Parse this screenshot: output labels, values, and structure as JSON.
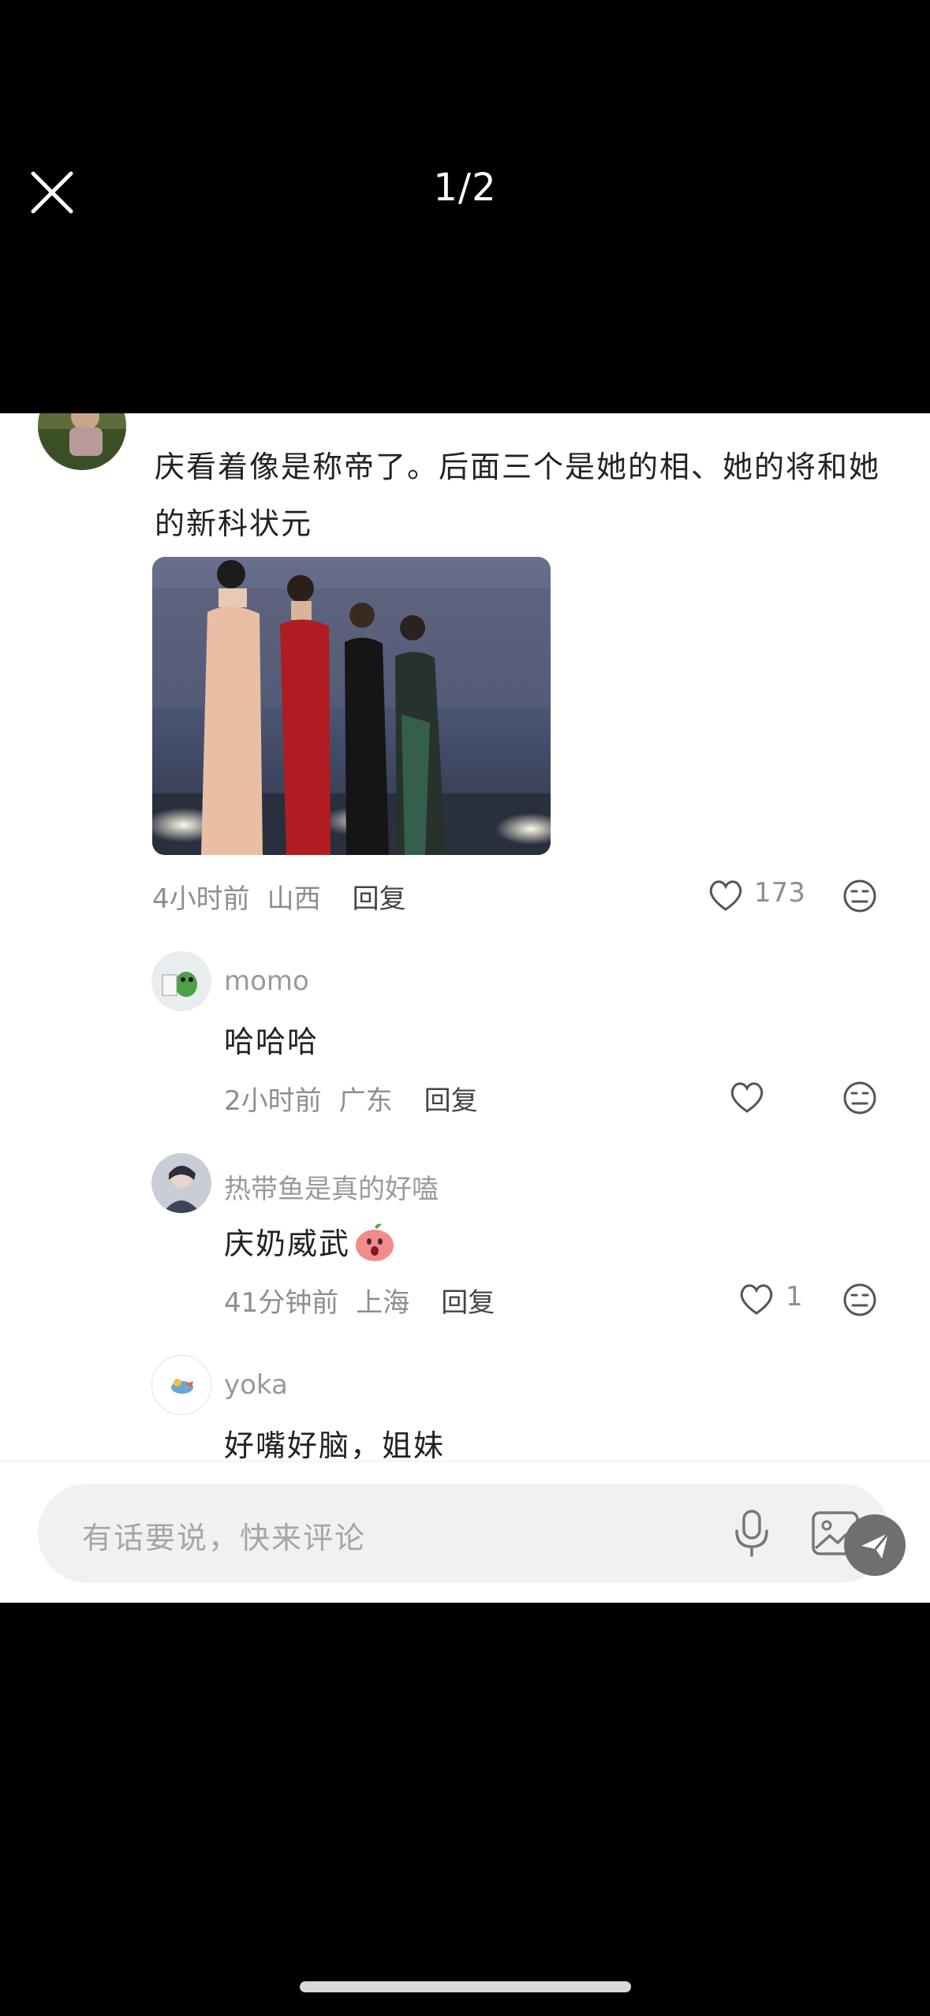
{
  "viewer": {
    "counter": "1/2"
  },
  "main_comment": {
    "text": "庆看着像是称帝了。后面三个是她的相、她的将和她的新科状元",
    "time": "4小时前",
    "location": "山西",
    "reply_label": "回复",
    "likes": "173"
  },
  "replies": [
    {
      "username": "momo",
      "text": "哈哈哈",
      "time": "2小时前",
      "location": "广东",
      "reply_label": "回复",
      "likes": ""
    },
    {
      "username": "热带鱼是真的好嗑",
      "text": "庆奶威武",
      "time": "41分钟前",
      "location": "上海",
      "reply_label": "回复",
      "likes": "1"
    },
    {
      "username": "yoka",
      "text": "好嘴好脑，姐妹"
    }
  ],
  "composer": {
    "placeholder": "有话要说，快来评论"
  },
  "icons": {
    "close": "close-icon",
    "like": "heart-outline-icon",
    "react": "emoji-face-icon",
    "mic": "microphone-icon",
    "image": "image-icon",
    "float": "send-icon",
    "emoji": "surprised-peach-emoji"
  },
  "colors": {
    "background": "#000000",
    "panel": "#ffffff",
    "muted_text": "#8e8e8e",
    "body_text": "#222222"
  }
}
